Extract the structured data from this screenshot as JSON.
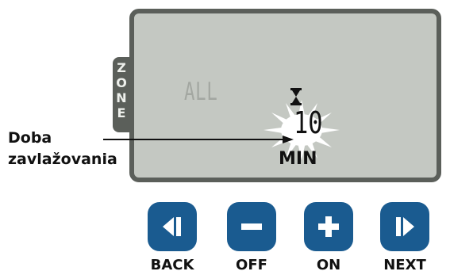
{
  "display": {
    "zone_label": [
      "Z",
      "O",
      "N",
      "E"
    ],
    "zone_selection": "ALL",
    "time_value": "10",
    "time_unit": "MIN"
  },
  "callout": {
    "line1": "Doba",
    "line2": "zavlažovania"
  },
  "buttons": [
    {
      "name": "back",
      "label": "BACK",
      "icon": "back-icon"
    },
    {
      "name": "off",
      "label": "OFF",
      "icon": "minus-icon"
    },
    {
      "name": "on",
      "label": "ON",
      "icon": "plus-icon"
    },
    {
      "name": "next",
      "label": "NEXT",
      "icon": "next-icon"
    }
  ],
  "colors": {
    "button": "#1a5b90",
    "lcd_background": "#c4c8c2",
    "frame": "#5b5f5a"
  }
}
